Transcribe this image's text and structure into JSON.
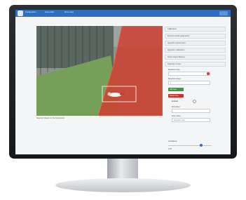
{
  "app": {
    "nav": [
      "Configuration",
      "Zone editor",
      "Zone notes"
    ]
  },
  "video": {
    "caption": "Segment objects in the foreground"
  },
  "panel": {
    "sections": [
      "Calibration",
      "Environmental parameters",
      "Algorithm parameters",
      "Algorithm calibration",
      "Ghost object filtering",
      "Detection zones"
    ],
    "zone_color_label": "Detection zone",
    "zone_list_label": "Detection zones",
    "zone_index_value": "1",
    "add_zone_label": "Add zone",
    "delete_zone_label": "Delete zone",
    "enable_label": "Enabled",
    "id_label": "ID number",
    "zone_name_label": "Zone name",
    "zone_name_value": "Detection zone",
    "confidence_label": "Confidence",
    "confidence_value": "0.75"
  },
  "colors": {
    "accent": "#2e6fc4",
    "zone_fill": "#d23c2c",
    "add": "#3c9a3c",
    "delete": "#cc2f2f"
  },
  "icons": [
    "monitor-icon"
  ]
}
